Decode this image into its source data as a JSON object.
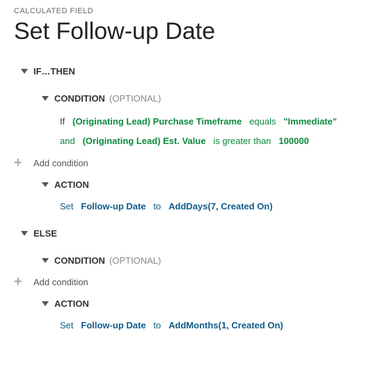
{
  "breadcrumb": "CALCULATED FIELD",
  "title": "Set Follow-up Date",
  "ifthen": {
    "label": "IF…THEN",
    "condition": {
      "label": "CONDITION",
      "optional": "(OPTIONAL)",
      "line1": {
        "kw": "If",
        "field": "(Originating Lead) Purchase Timeframe",
        "op": "equals",
        "value": "\"Immediate\""
      },
      "line2": {
        "kw": "and",
        "field": "(Originating Lead) Est. Value",
        "op": "is greater than",
        "value": "100000"
      },
      "add": "Add condition"
    },
    "action": {
      "label": "ACTION",
      "kw1": "Set",
      "field": "Follow-up Date",
      "kw2": "to",
      "fn": "AddDays(7, Created On)"
    }
  },
  "else": {
    "label": "ELSE",
    "condition": {
      "label": "CONDITION",
      "optional": "(OPTIONAL)",
      "add": "Add condition"
    },
    "action": {
      "label": "ACTION",
      "kw1": "Set",
      "field": "Follow-up Date",
      "kw2": "to",
      "fn": "AddMonths(1, Created On)"
    }
  }
}
